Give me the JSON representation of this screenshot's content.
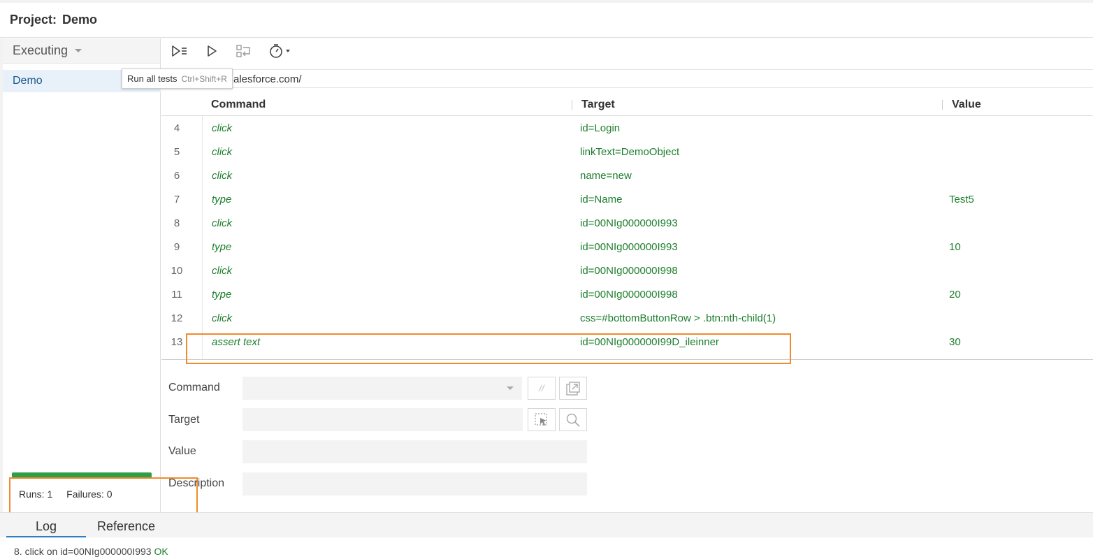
{
  "project": {
    "label": "Project:",
    "name": "Demo"
  },
  "sidebar": {
    "dropdown_label": "Executing",
    "items": [
      {
        "label": "Demo"
      }
    ],
    "runs_label": "Runs: 1",
    "failures_label": "Failures: 0",
    "progress_fraction": 1.0,
    "progress_color": "#2e9e4b"
  },
  "toolbar": {
    "buttons": [
      {
        "icon": "run-all-tests-icon"
      },
      {
        "icon": "run-current-test-icon"
      },
      {
        "icon": "step-over-icon"
      },
      {
        "icon": "speed-timer-icon"
      }
    ],
    "tooltip": {
      "text": "Run all tests",
      "shortcut": "Ctrl+Shift+R"
    }
  },
  "url": {
    "visible_text": "alesforce.com/"
  },
  "grid": {
    "headers": {
      "command": "Command",
      "target": "Target",
      "value": "Value"
    },
    "rows": [
      {
        "num": "4",
        "command": "click",
        "target": "id=Login",
        "value": ""
      },
      {
        "num": "5",
        "command": "click",
        "target": "linkText=DemoObject",
        "value": ""
      },
      {
        "num": "6",
        "command": "click",
        "target": "name=new",
        "value": ""
      },
      {
        "num": "7",
        "command": "type",
        "target": "id=Name",
        "value": "Test5"
      },
      {
        "num": "8",
        "command": "click",
        "target": "id=00NIg000000I993",
        "value": ""
      },
      {
        "num": "9",
        "command": "type",
        "target": "id=00NIg000000I993",
        "value": "10"
      },
      {
        "num": "10",
        "command": "click",
        "target": "id=00NIg000000I998",
        "value": ""
      },
      {
        "num": "11",
        "command": "type",
        "target": "id=00NIg000000I998",
        "value": "20"
      },
      {
        "num": "12",
        "command": "click",
        "target": "css=#bottomButtonRow > .btn:nth-child(1)",
        "value": ""
      },
      {
        "num": "13",
        "command": "assert text",
        "target": "id=00NIg000000I99D_ileinner",
        "value": "30"
      }
    ],
    "highlight_color": "#f08a2c",
    "command_color": "#1d7e2d"
  },
  "editor": {
    "command_label": "Command",
    "target_label": "Target",
    "value_label": "Value",
    "description_label": "Description",
    "command_value": "",
    "target_value": "",
    "value_value": "",
    "description_value": ""
  },
  "bottom": {
    "tabs": [
      {
        "label": "Log",
        "active": true
      },
      {
        "label": "Reference",
        "active": false
      }
    ],
    "log_line": {
      "index": "8.",
      "text": "click on id=00NIg000000I993",
      "status": "OK"
    }
  }
}
